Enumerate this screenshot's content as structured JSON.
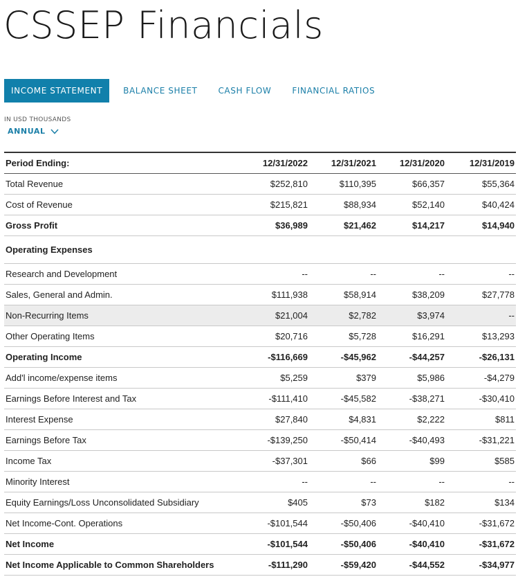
{
  "page": {
    "title": "CSSEP Financials"
  },
  "tabs": [
    {
      "label": "INCOME STATEMENT",
      "active": true
    },
    {
      "label": "BALANCE SHEET",
      "active": false
    },
    {
      "label": "CASH FLOW",
      "active": false
    },
    {
      "label": "FINANCIAL RATIOS",
      "active": false
    }
  ],
  "units": "IN USD THOUSANDS",
  "period_select": {
    "value": "ANNUAL",
    "icon": "chevron-down-icon"
  },
  "colors": {
    "accent": "#1180ab",
    "link": "#1b7fa8",
    "highlight_row": "#ececec"
  },
  "table": {
    "header": [
      "Period Ending:",
      "12/31/2022",
      "12/31/2021",
      "12/31/2020",
      "12/31/2019"
    ],
    "rows": [
      {
        "label": "Total Revenue",
        "values": [
          "$252,810",
          "$110,395",
          "$66,357",
          "$55,364"
        ]
      },
      {
        "label": "Cost of Revenue",
        "values": [
          "$215,821",
          "$88,934",
          "$52,140",
          "$40,424"
        ]
      },
      {
        "label": "Gross Profit",
        "values": [
          "$36,989",
          "$21,462",
          "$14,217",
          "$14,940"
        ],
        "bold": true
      },
      {
        "label": "Operating Expenses",
        "values": [
          "",
          "",
          "",
          ""
        ],
        "section": true
      },
      {
        "label": "Research and Development",
        "values": [
          "--",
          "--",
          "--",
          "--"
        ]
      },
      {
        "label": "Sales, General and Admin.",
        "values": [
          "$111,938",
          "$58,914",
          "$38,209",
          "$27,778"
        ]
      },
      {
        "label": "Non-Recurring Items",
        "values": [
          "$21,004",
          "$2,782",
          "$3,974",
          "--"
        ],
        "highlight": true
      },
      {
        "label": "Other Operating Items",
        "values": [
          "$20,716",
          "$5,728",
          "$16,291",
          "$13,293"
        ]
      },
      {
        "label": "Operating Income",
        "values": [
          "-$116,669",
          "-$45,962",
          "-$44,257",
          "-$26,131"
        ],
        "bold": true
      },
      {
        "label": "Add'l income/expense items",
        "values": [
          "$5,259",
          "$379",
          "$5,986",
          "-$4,279"
        ]
      },
      {
        "label": "Earnings Before Interest and Tax",
        "values": [
          "-$111,410",
          "-$45,582",
          "-$38,271",
          "-$30,410"
        ]
      },
      {
        "label": "Interest Expense",
        "values": [
          "$27,840",
          "$4,831",
          "$2,222",
          "$811"
        ]
      },
      {
        "label": "Earnings Before Tax",
        "values": [
          "-$139,250",
          "-$50,414",
          "-$40,493",
          "-$31,221"
        ]
      },
      {
        "label": "Income Tax",
        "values": [
          "-$37,301",
          "$66",
          "$99",
          "$585"
        ]
      },
      {
        "label": "Minority Interest",
        "values": [
          "--",
          "--",
          "--",
          "--"
        ]
      },
      {
        "label": "Equity Earnings/Loss Unconsolidated Subsidiary",
        "values": [
          "$405",
          "$73",
          "$182",
          "$134"
        ]
      },
      {
        "label": "Net Income-Cont. Operations",
        "values": [
          "-$101,544",
          "-$50,406",
          "-$40,410",
          "-$31,672"
        ]
      },
      {
        "label": "Net Income",
        "values": [
          "-$101,544",
          "-$50,406",
          "-$40,410",
          "-$31,672"
        ],
        "bold": true
      },
      {
        "label": "Net Income Applicable to Common Shareholders",
        "values": [
          "-$111,290",
          "-$59,420",
          "-$44,552",
          "-$34,977"
        ],
        "bold": true
      }
    ]
  }
}
